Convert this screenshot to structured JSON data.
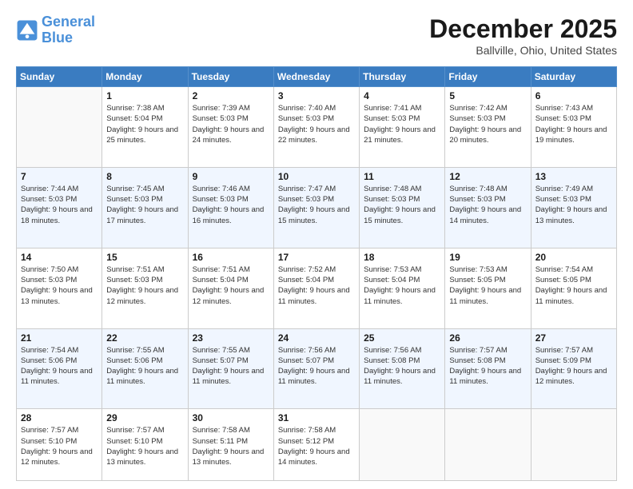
{
  "header": {
    "logo_general": "General",
    "logo_blue": "Blue",
    "month_title": "December 2025",
    "location": "Ballville, Ohio, United States"
  },
  "days_of_week": [
    "Sunday",
    "Monday",
    "Tuesday",
    "Wednesday",
    "Thursday",
    "Friday",
    "Saturday"
  ],
  "weeks": [
    [
      {
        "day": "",
        "sunrise": "",
        "sunset": "",
        "daylight": ""
      },
      {
        "day": "1",
        "sunrise": "Sunrise: 7:38 AM",
        "sunset": "Sunset: 5:04 PM",
        "daylight": "Daylight: 9 hours and 25 minutes."
      },
      {
        "day": "2",
        "sunrise": "Sunrise: 7:39 AM",
        "sunset": "Sunset: 5:03 PM",
        "daylight": "Daylight: 9 hours and 24 minutes."
      },
      {
        "day": "3",
        "sunrise": "Sunrise: 7:40 AM",
        "sunset": "Sunset: 5:03 PM",
        "daylight": "Daylight: 9 hours and 22 minutes."
      },
      {
        "day": "4",
        "sunrise": "Sunrise: 7:41 AM",
        "sunset": "Sunset: 5:03 PM",
        "daylight": "Daylight: 9 hours and 21 minutes."
      },
      {
        "day": "5",
        "sunrise": "Sunrise: 7:42 AM",
        "sunset": "Sunset: 5:03 PM",
        "daylight": "Daylight: 9 hours and 20 minutes."
      },
      {
        "day": "6",
        "sunrise": "Sunrise: 7:43 AM",
        "sunset": "Sunset: 5:03 PM",
        "daylight": "Daylight: 9 hours and 19 minutes."
      }
    ],
    [
      {
        "day": "7",
        "sunrise": "Sunrise: 7:44 AM",
        "sunset": "Sunset: 5:03 PM",
        "daylight": "Daylight: 9 hours and 18 minutes."
      },
      {
        "day": "8",
        "sunrise": "Sunrise: 7:45 AM",
        "sunset": "Sunset: 5:03 PM",
        "daylight": "Daylight: 9 hours and 17 minutes."
      },
      {
        "day": "9",
        "sunrise": "Sunrise: 7:46 AM",
        "sunset": "Sunset: 5:03 PM",
        "daylight": "Daylight: 9 hours and 16 minutes."
      },
      {
        "day": "10",
        "sunrise": "Sunrise: 7:47 AM",
        "sunset": "Sunset: 5:03 PM",
        "daylight": "Daylight: 9 hours and 15 minutes."
      },
      {
        "day": "11",
        "sunrise": "Sunrise: 7:48 AM",
        "sunset": "Sunset: 5:03 PM",
        "daylight": "Daylight: 9 hours and 15 minutes."
      },
      {
        "day": "12",
        "sunrise": "Sunrise: 7:48 AM",
        "sunset": "Sunset: 5:03 PM",
        "daylight": "Daylight: 9 hours and 14 minutes."
      },
      {
        "day": "13",
        "sunrise": "Sunrise: 7:49 AM",
        "sunset": "Sunset: 5:03 PM",
        "daylight": "Daylight: 9 hours and 13 minutes."
      }
    ],
    [
      {
        "day": "14",
        "sunrise": "Sunrise: 7:50 AM",
        "sunset": "Sunset: 5:03 PM",
        "daylight": "Daylight: 9 hours and 13 minutes."
      },
      {
        "day": "15",
        "sunrise": "Sunrise: 7:51 AM",
        "sunset": "Sunset: 5:03 PM",
        "daylight": "Daylight: 9 hours and 12 minutes."
      },
      {
        "day": "16",
        "sunrise": "Sunrise: 7:51 AM",
        "sunset": "Sunset: 5:04 PM",
        "daylight": "Daylight: 9 hours and 12 minutes."
      },
      {
        "day": "17",
        "sunrise": "Sunrise: 7:52 AM",
        "sunset": "Sunset: 5:04 PM",
        "daylight": "Daylight: 9 hours and 11 minutes."
      },
      {
        "day": "18",
        "sunrise": "Sunrise: 7:53 AM",
        "sunset": "Sunset: 5:04 PM",
        "daylight": "Daylight: 9 hours and 11 minutes."
      },
      {
        "day": "19",
        "sunrise": "Sunrise: 7:53 AM",
        "sunset": "Sunset: 5:05 PM",
        "daylight": "Daylight: 9 hours and 11 minutes."
      },
      {
        "day": "20",
        "sunrise": "Sunrise: 7:54 AM",
        "sunset": "Sunset: 5:05 PM",
        "daylight": "Daylight: 9 hours and 11 minutes."
      }
    ],
    [
      {
        "day": "21",
        "sunrise": "Sunrise: 7:54 AM",
        "sunset": "Sunset: 5:06 PM",
        "daylight": "Daylight: 9 hours and 11 minutes."
      },
      {
        "day": "22",
        "sunrise": "Sunrise: 7:55 AM",
        "sunset": "Sunset: 5:06 PM",
        "daylight": "Daylight: 9 hours and 11 minutes."
      },
      {
        "day": "23",
        "sunrise": "Sunrise: 7:55 AM",
        "sunset": "Sunset: 5:07 PM",
        "daylight": "Daylight: 9 hours and 11 minutes."
      },
      {
        "day": "24",
        "sunrise": "Sunrise: 7:56 AM",
        "sunset": "Sunset: 5:07 PM",
        "daylight": "Daylight: 9 hours and 11 minutes."
      },
      {
        "day": "25",
        "sunrise": "Sunrise: 7:56 AM",
        "sunset": "Sunset: 5:08 PM",
        "daylight": "Daylight: 9 hours and 11 minutes."
      },
      {
        "day": "26",
        "sunrise": "Sunrise: 7:57 AM",
        "sunset": "Sunset: 5:08 PM",
        "daylight": "Daylight: 9 hours and 11 minutes."
      },
      {
        "day": "27",
        "sunrise": "Sunrise: 7:57 AM",
        "sunset": "Sunset: 5:09 PM",
        "daylight": "Daylight: 9 hours and 12 minutes."
      }
    ],
    [
      {
        "day": "28",
        "sunrise": "Sunrise: 7:57 AM",
        "sunset": "Sunset: 5:10 PM",
        "daylight": "Daylight: 9 hours and 12 minutes."
      },
      {
        "day": "29",
        "sunrise": "Sunrise: 7:57 AM",
        "sunset": "Sunset: 5:10 PM",
        "daylight": "Daylight: 9 hours and 13 minutes."
      },
      {
        "day": "30",
        "sunrise": "Sunrise: 7:58 AM",
        "sunset": "Sunset: 5:11 PM",
        "daylight": "Daylight: 9 hours and 13 minutes."
      },
      {
        "day": "31",
        "sunrise": "Sunrise: 7:58 AM",
        "sunset": "Sunset: 5:12 PM",
        "daylight": "Daylight: 9 hours and 14 minutes."
      },
      {
        "day": "",
        "sunrise": "",
        "sunset": "",
        "daylight": ""
      },
      {
        "day": "",
        "sunrise": "",
        "sunset": "",
        "daylight": ""
      },
      {
        "day": "",
        "sunrise": "",
        "sunset": "",
        "daylight": ""
      }
    ]
  ]
}
